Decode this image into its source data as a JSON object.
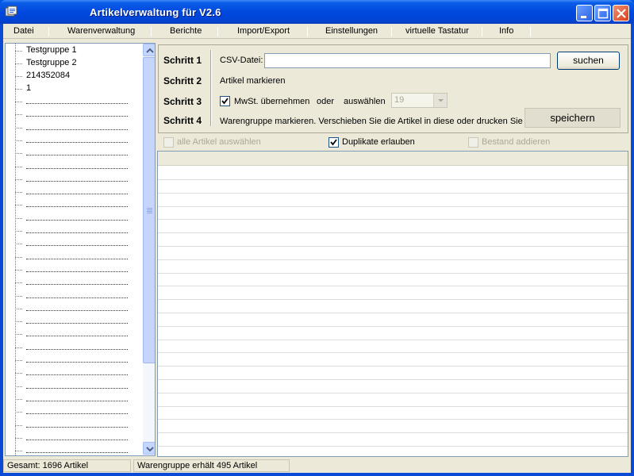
{
  "window": {
    "title": "Artikelverwaltung für V2.6"
  },
  "menu": [
    "Datei",
    "Warenverwaltung",
    "Berichte",
    "Import/Export",
    "Einstellungen",
    "virtuelle Tastatur",
    "Info"
  ],
  "tree": {
    "items": [
      "Testgruppe 1",
      "Testgruppe 2",
      "214352084",
      "1"
    ]
  },
  "steps": {
    "step1": {
      "label": "Schritt 1",
      "field_label": "CSV-Datei:",
      "value": "",
      "button": "suchen"
    },
    "step2": {
      "label": "Schritt 2",
      "text": "Artikel markieren"
    },
    "step3": {
      "label": "Schritt 3",
      "checkbox_label": "MwSt. übernehmen",
      "checked": true,
      "oder": "oder",
      "auswaehlen": "auswählen",
      "combo_value": "19"
    },
    "step4": {
      "label": "Schritt 4",
      "text": "Warengruppe markieren. Verschieben Sie die Artikel in diese oder drucken Sie",
      "button": "speichern"
    }
  },
  "options": {
    "select_all": {
      "label": "alle Artikel auswählen",
      "checked": false,
      "enabled": false
    },
    "duplicates": {
      "label": "Duplikate erlauben",
      "checked": true,
      "enabled": true
    },
    "add_stock": {
      "label": "Bestand addieren",
      "checked": false,
      "enabled": false
    }
  },
  "status": {
    "total": "Gesamt: 1696 Artikel",
    "group": "Warengruppe erhält 495 Artikel"
  }
}
